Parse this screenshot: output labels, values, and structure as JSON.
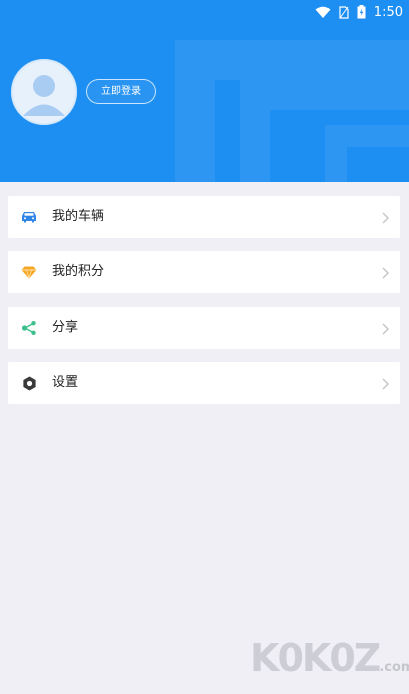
{
  "status_bar": {
    "time": "1:50",
    "icons": [
      "wifi-icon",
      "sim-icon",
      "battery-icon"
    ]
  },
  "profile": {
    "login_label": "立即登录",
    "avatar_icon": "avatar-placeholder-icon"
  },
  "menu": [
    {
      "label": "我的车辆",
      "icon": "car-icon",
      "color": "#2f86e6"
    },
    {
      "label": "我的积分",
      "icon": "gem-icon",
      "color": "#f5a623"
    },
    {
      "label": "分享",
      "icon": "share-icon",
      "color": "#3cc08b"
    },
    {
      "label": "设置",
      "icon": "settings-icon",
      "color": "#3a3a3a"
    }
  ],
  "watermark": {
    "main": "K0K0Z",
    "suffix": ".com"
  },
  "colors": {
    "header": "#1e8ff2",
    "background": "#efeff5"
  }
}
